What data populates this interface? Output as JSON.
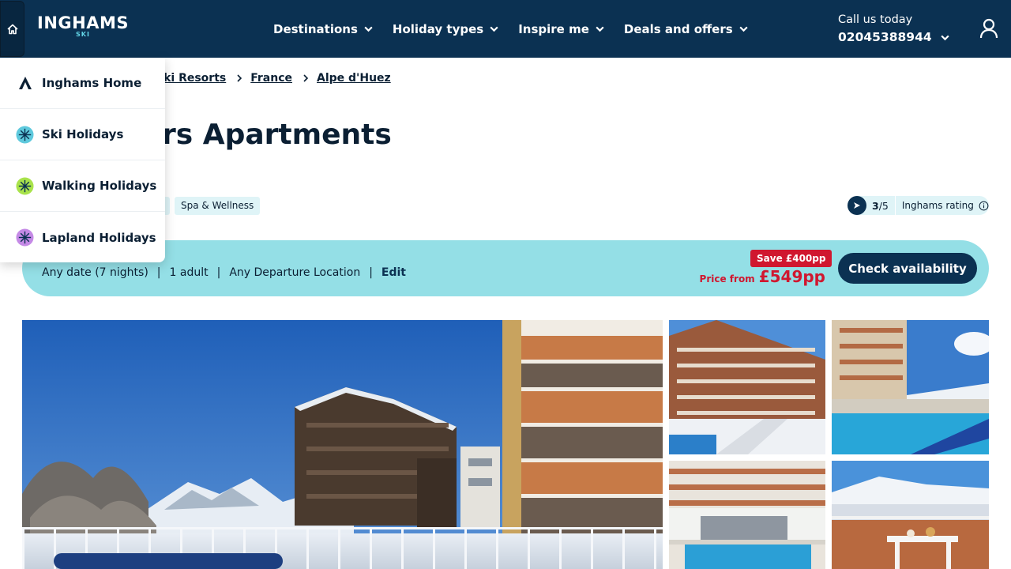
{
  "header": {
    "logo_text": "INGHAMS",
    "logo_sub": "SKI",
    "nav": [
      {
        "label": "Destinations"
      },
      {
        "label": "Holiday types"
      },
      {
        "label": "Inspire me"
      },
      {
        "label": "Deals and offers"
      }
    ],
    "call_label": "Call us today",
    "call_number": "02045388944"
  },
  "menu": {
    "items": [
      {
        "label": "Inghams Home",
        "icon": "inghams-logo-icon"
      },
      {
        "label": "Ski Holidays",
        "icon": "snowflake-icon",
        "color": "#5ec9dd"
      },
      {
        "label": "Walking Holidays",
        "icon": "snowflake-icon",
        "color": "#a9e34b"
      },
      {
        "label": "Lapland Holidays",
        "icon": "snowflake-icon",
        "color": "#c58ae6"
      }
    ]
  },
  "breadcrumb": [
    "Ski Resorts",
    "France",
    "Alpe d'Huez"
  ],
  "page_title": "rs Apartments",
  "tags": [
    "Spa & Wellness"
  ],
  "rating": {
    "score": "3",
    "out_of": "/5",
    "label": "Inghams rating"
  },
  "search": {
    "date": "Any date (7 nights)",
    "guests": "1 adult",
    "departure": "Any Departure Location",
    "edit_label": "Edit",
    "save_badge": "Save £400pp",
    "price_label": "Price from",
    "price_value": "£549pp",
    "cta": "Check availability"
  },
  "colors": {
    "header_bg": "#0b3152",
    "accent_cyan": "#94dfe6",
    "sale_red": "#d0172f",
    "tag_bg": "#dff4f7"
  }
}
